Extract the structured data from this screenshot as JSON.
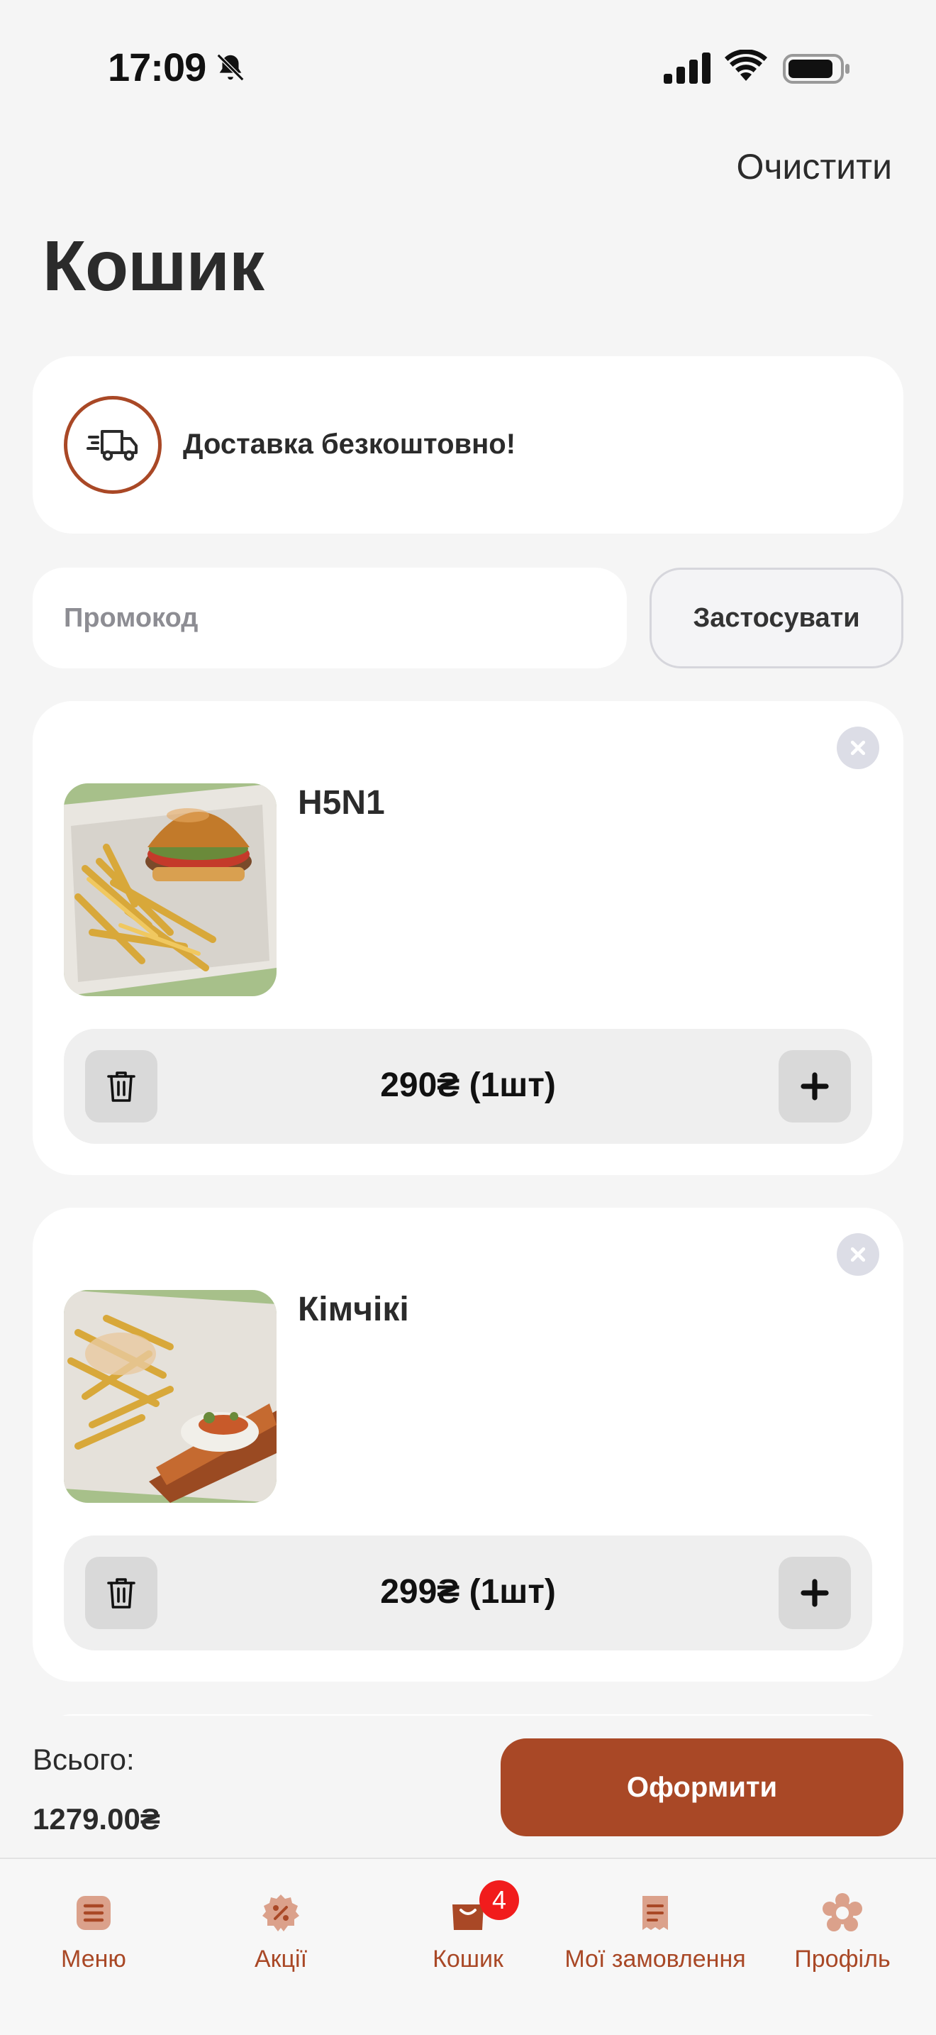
{
  "status_bar": {
    "time": "17:09"
  },
  "header": {
    "clear_label": "Очистити",
    "title": "Кошик"
  },
  "delivery": {
    "text": "Доставка безкоштовно!",
    "icon": "truck-icon"
  },
  "promo": {
    "placeholder": "Промокод",
    "value": "",
    "apply_label": "Застосувати"
  },
  "items": [
    {
      "name": "H5N1",
      "price_qty": "290₴ (1шт)",
      "image": "burger-with-fries"
    },
    {
      "name": "Кімчікі",
      "price_qty": "299₴ (1шт)",
      "image": "hotdog-with-fries"
    }
  ],
  "summary": {
    "total_label": "Всього:",
    "total_value": "1279.00₴",
    "checkout_label": "Оформити"
  },
  "tabs": [
    {
      "label": "Меню",
      "icon": "menu-icon"
    },
    {
      "label": "Акції",
      "icon": "discount-icon"
    },
    {
      "label": "Кошик",
      "icon": "bag-icon",
      "badge": "4"
    },
    {
      "label": "Мої замовлення",
      "icon": "receipt-icon"
    },
    {
      "label": "Профіль",
      "icon": "profile-icon"
    }
  ],
  "colors": {
    "accent": "#a94826",
    "background": "#f5f5f5",
    "badge": "#f11c1c"
  }
}
